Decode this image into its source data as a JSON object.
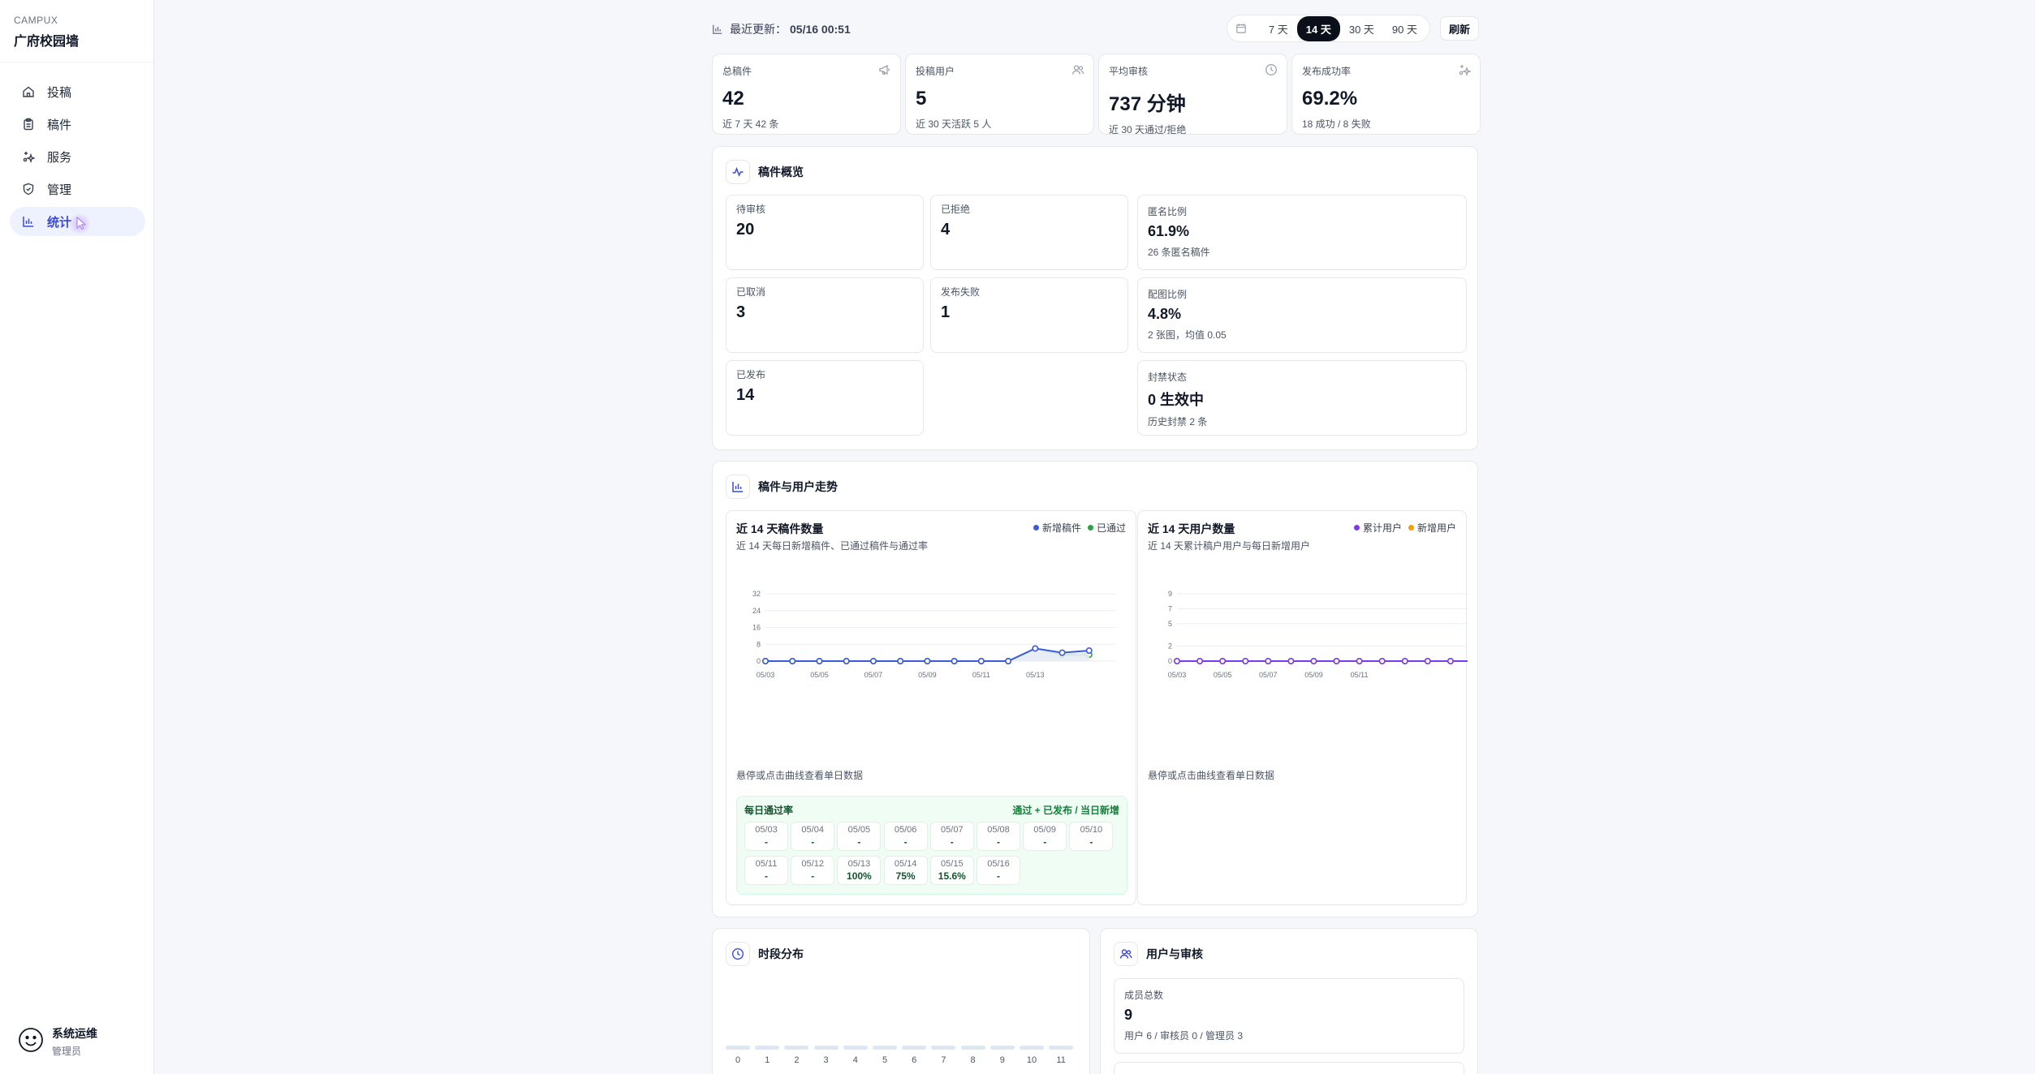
{
  "sidebar": {
    "brand_sub": "CAMPUX",
    "brand_title": "广府校园墙",
    "items": [
      {
        "label": "投稿",
        "icon": "home-icon"
      },
      {
        "label": "稿件",
        "icon": "clipboard-icon"
      },
      {
        "label": "服务",
        "icon": "sparkle-icon"
      },
      {
        "label": "管理",
        "icon": "shield-icon"
      },
      {
        "label": "统计",
        "icon": "bar-chart-icon",
        "active": true
      }
    ],
    "user": {
      "name": "系统运维",
      "role": "管理员"
    }
  },
  "topbar": {
    "updated_label": "最近更新：",
    "updated_value": "05/16 00:51",
    "ranges": [
      "7 天",
      "14 天",
      "30 天",
      "90 天"
    ],
    "selected_range": "14 天",
    "refresh_label": "刷新"
  },
  "kpis": [
    {
      "label": "总稿件",
      "value": "42",
      "sub": "近 7 天 42 条",
      "icon": "megaphone-icon"
    },
    {
      "label": "投稿用户",
      "value": "5",
      "sub": "近 30 天活跃 5 人",
      "icon": "users-icon"
    },
    {
      "label": "平均审核",
      "value": "737 分钟",
      "sub": "近 30 天通过/拒绝",
      "icon": "clock-icon"
    },
    {
      "label": "发布成功率",
      "value": "69.2%",
      "sub": "18 成功 / 8 失败",
      "icon": "sparkle-icon"
    }
  ],
  "overview": {
    "title": "稿件概览",
    "stats": [
      {
        "label": "待审核",
        "value": "20"
      },
      {
        "label": "已拒绝",
        "value": "4"
      },
      {
        "label": "已取消",
        "value": "3"
      },
      {
        "label": "发布失败",
        "value": "1"
      },
      {
        "label": "已发布",
        "value": "14"
      }
    ],
    "side": [
      {
        "label": "匿名比例",
        "value": "61.9%",
        "sub": "26 条匿名稿件"
      },
      {
        "label": "配图比例",
        "value": "4.8%",
        "sub": "2 张图，均值 0.05"
      },
      {
        "label": "封禁状态",
        "value": "0 生效中",
        "sub": "历史封禁 2 条"
      }
    ]
  },
  "trends": {
    "title": "稿件与用户走势",
    "hint": "悬停或点击曲线查看单日数据",
    "rate_title": "每日通过率",
    "rate_rule": "通过 + 已发布 / 当日新增",
    "rates": [
      {
        "d": "05/03",
        "v": "-"
      },
      {
        "d": "05/04",
        "v": "-"
      },
      {
        "d": "05/05",
        "v": "-"
      },
      {
        "d": "05/06",
        "v": "-"
      },
      {
        "d": "05/07",
        "v": "-"
      },
      {
        "d": "05/08",
        "v": "-"
      },
      {
        "d": "05/09",
        "v": "-"
      },
      {
        "d": "05/10",
        "v": "-"
      },
      {
        "d": "05/11",
        "v": "-"
      },
      {
        "d": "05/12",
        "v": "-"
      },
      {
        "d": "05/13",
        "v": "100%"
      },
      {
        "d": "05/14",
        "v": "75%"
      },
      {
        "d": "05/15",
        "v": "15.6%"
      },
      {
        "d": "05/16",
        "v": "-"
      }
    ]
  },
  "chart_data": [
    {
      "type": "line",
      "title": "近 14 天稿件数量",
      "subtitle": "近 14 天每日新增稿件、已通过稿件与通过率",
      "x": [
        "05/03",
        "05/04",
        "05/05",
        "05/06",
        "05/07",
        "05/08",
        "05/09",
        "05/10",
        "05/11",
        "05/12",
        "05/13",
        "05/14",
        "05/15",
        "05/16"
      ],
      "x_tick_labels": [
        "05/03",
        "05/05",
        "05/07",
        "05/09",
        "05/11",
        "05/13"
      ],
      "ylim": [
        0,
        32
      ],
      "y_ticks": [
        0,
        8,
        16,
        24,
        32
      ],
      "grid": true,
      "legend": "top-right",
      "series": [
        {
          "name": "新增稿件",
          "color": "#3b5bdb",
          "values": [
            0,
            0,
            0,
            0,
            0,
            0,
            0,
            0,
            0,
            0,
            6,
            4,
            5,
            null
          ]
        },
        {
          "name": "已通过",
          "color": "#2f9e44",
          "values": [
            0,
            0,
            0,
            0,
            0,
            0,
            0,
            0,
            0,
            0,
            6,
            3,
            3,
            null
          ]
        }
      ]
    },
    {
      "type": "line",
      "title": "近 14 天用户数量",
      "subtitle": "近 14 天累计稿户用户与每日新增用户",
      "x": [
        "05/03",
        "05/04",
        "05/05",
        "05/06",
        "05/07",
        "05/08",
        "05/09",
        "05/10",
        "05/11",
        "05/12",
        "05/13",
        "05/14",
        "05/15",
        "05/16"
      ],
      "x_tick_labels": [
        "05/03",
        "05/05",
        "05/07",
        "05/09",
        "05/11"
      ],
      "ylim": [
        0,
        9
      ],
      "y_ticks": [
        0,
        2,
        5,
        7,
        9
      ],
      "grid": true,
      "legend": "top-right",
      "series": [
        {
          "name": "累计用户",
          "color": "#7c3aed",
          "values": [
            0,
            0,
            0,
            0,
            0,
            0,
            0,
            0,
            0,
            0,
            0,
            0,
            0,
            0
          ]
        },
        {
          "name": "新增用户",
          "color": "#f59f00",
          "values": [
            0,
            0,
            0,
            0,
            0,
            0,
            0,
            0,
            0,
            0,
            0,
            0,
            0,
            0
          ]
        }
      ]
    },
    {
      "type": "bar",
      "title": "时段分布",
      "categories": [
        "0",
        "1",
        "2",
        "3",
        "4",
        "5",
        "6",
        "7",
        "8",
        "9",
        "10",
        "11"
      ],
      "values": [
        0,
        0,
        0,
        0,
        0,
        0,
        0,
        0,
        0,
        0,
        0,
        0
      ],
      "color": "#dbe7f3"
    }
  ],
  "users_review": {
    "title": "用户与审核",
    "members_label": "成员总数",
    "members_value": "9",
    "members_sub": "用户 6 / 审核员 0 / 管理员 3"
  },
  "colors": {
    "accent": "#3b4bd8",
    "dark": "#0b0f1a",
    "green": "#15803d"
  }
}
